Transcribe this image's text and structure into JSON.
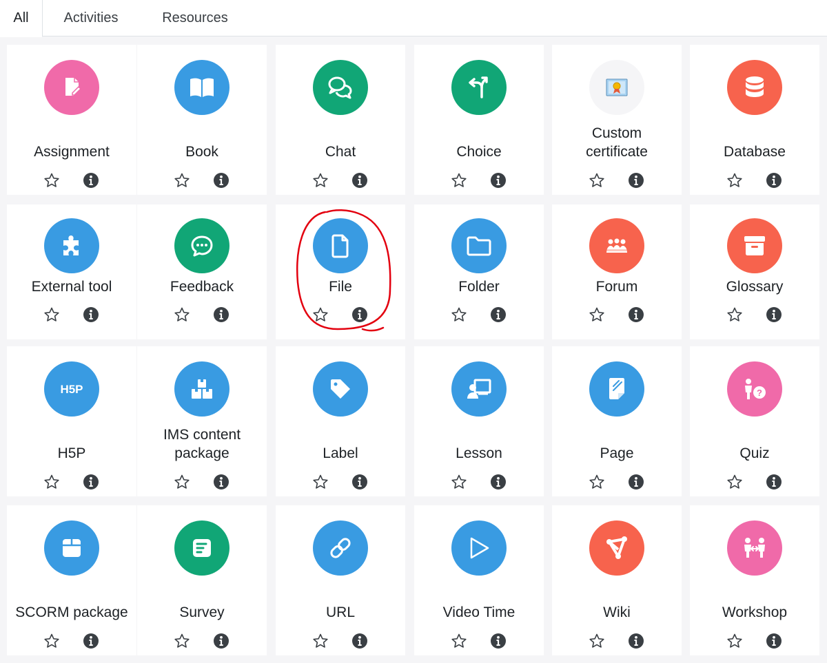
{
  "tabs": [
    {
      "label": "All",
      "active": true
    },
    {
      "label": "Activities",
      "active": false
    },
    {
      "label": "Resources",
      "active": false
    }
  ],
  "colors": {
    "pink": "#f06aa9",
    "blue": "#399be2",
    "green": "#11a676",
    "orange": "#f7634d",
    "certificate_bg": "#f5f5f7",
    "annotation": "#e3000f"
  },
  "modules": [
    {
      "label": "Assignment",
      "icon": "assignment-icon",
      "color": "pink"
    },
    {
      "label": "Book",
      "icon": "book-icon",
      "color": "blue"
    },
    {
      "label": "Chat",
      "icon": "chat-icon",
      "color": "green"
    },
    {
      "label": "Choice",
      "icon": "choice-icon",
      "color": "green"
    },
    {
      "label": "Custom certificate",
      "icon": "certificate-icon",
      "color": "certificate"
    },
    {
      "label": "Database",
      "icon": "database-icon",
      "color": "orange"
    },
    {
      "label": "External tool",
      "icon": "puzzle-icon",
      "color": "blue"
    },
    {
      "label": "Feedback",
      "icon": "feedback-icon",
      "color": "green"
    },
    {
      "label": "File",
      "icon": "file-icon",
      "color": "blue"
    },
    {
      "label": "Folder",
      "icon": "folder-icon",
      "color": "blue"
    },
    {
      "label": "Forum",
      "icon": "forum-icon",
      "color": "orange"
    },
    {
      "label": "Glossary",
      "icon": "glossary-icon",
      "color": "orange"
    },
    {
      "label": "H5P",
      "icon": "h5p-icon",
      "color": "blue"
    },
    {
      "label": "IMS content package",
      "icon": "ims-icon",
      "color": "blue"
    },
    {
      "label": "Label",
      "icon": "tag-icon",
      "color": "blue"
    },
    {
      "label": "Lesson",
      "icon": "lesson-icon",
      "color": "blue"
    },
    {
      "label": "Page",
      "icon": "page-icon",
      "color": "blue"
    },
    {
      "label": "Quiz",
      "icon": "quiz-icon",
      "color": "pink"
    },
    {
      "label": "SCORM package",
      "icon": "scorm-icon",
      "color": "blue"
    },
    {
      "label": "Survey",
      "icon": "survey-icon",
      "color": "green"
    },
    {
      "label": "URL",
      "icon": "link-icon",
      "color": "blue"
    },
    {
      "label": "Video Time",
      "icon": "play-icon",
      "color": "blue"
    },
    {
      "label": "Wiki",
      "icon": "wiki-icon",
      "color": "orange"
    },
    {
      "label": "Workshop",
      "icon": "workshop-icon",
      "color": "pink"
    }
  ]
}
